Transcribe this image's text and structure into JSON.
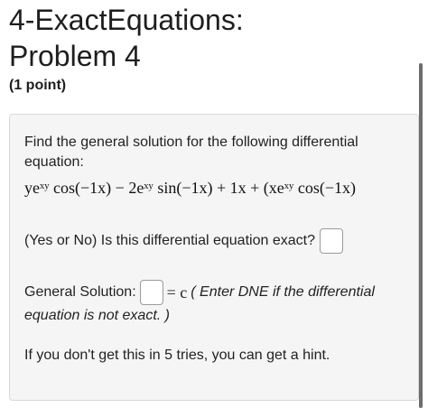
{
  "page": {
    "title_line1": "4-ExactEquations:",
    "title_line2": "Problem 4",
    "points": "(1 point)"
  },
  "problem": {
    "intro": "Find the general solution for the following differential equation:",
    "equation": "yeˣʸ cos(−1x) − 2eˣʸ sin(−1x) + 1x + (xeˣʸ cos(−1x)",
    "exact_question": "(Yes or No) Is this differential equation exact?",
    "general_label": "General Solution:",
    "general_rhs": "= c",
    "general_note_1": "( Enter DNE if the differential",
    "general_note_2": "equation is not exact. )",
    "hint": "If you don't get this in 5 tries, you can get a hint."
  },
  "inputs": {
    "exact_answer": "",
    "general_solution": ""
  }
}
